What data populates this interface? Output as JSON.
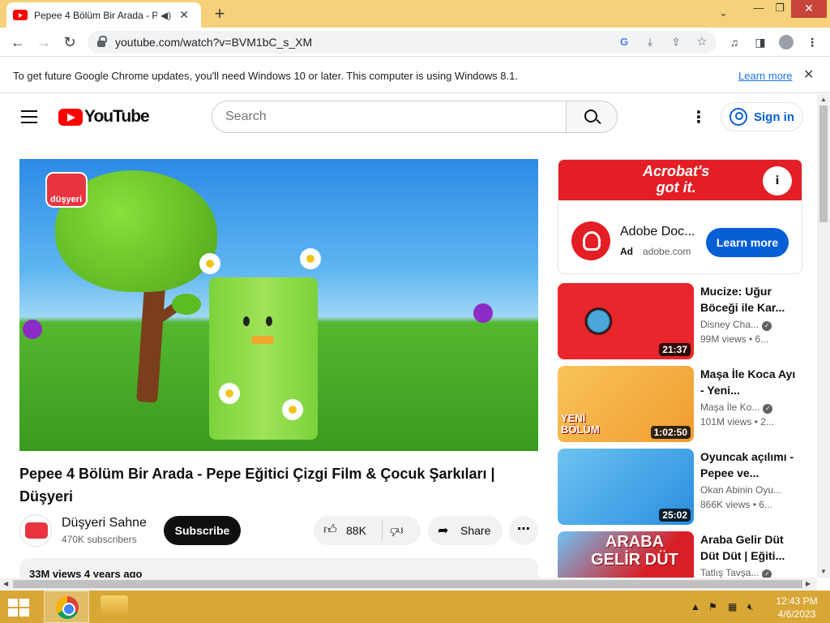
{
  "browser": {
    "tab_title": "Pepee 4 Bölüm Bir Arada - Pe",
    "url": "youtube.com/watch?v=BVM1bC_s_XM",
    "icons": [
      "youtube-favicon",
      "audio-icon",
      "close-icon",
      "new-tab-icon",
      "back-icon",
      "forward-icon",
      "reload-icon",
      "lock-icon",
      "google-icon",
      "download-icon",
      "share-icon",
      "star-icon",
      "media-icon",
      "side-panel-icon",
      "profile-icon",
      "menu-icon"
    ]
  },
  "infobar": {
    "message": "To get future Google Chrome updates, you'll need Windows 10 or later. This computer is using Windows 8.1.",
    "link": "Learn more"
  },
  "youtube": {
    "brand": "YouTube",
    "search_placeholder": "Search",
    "sign_in": "Sign in",
    "brand_color": "#ff0000",
    "accent_color": "#065fd4"
  },
  "player": {
    "channel_mark": "düşyeri"
  },
  "video": {
    "title": "Pepee 4 Bölüm Bir Arada - Pepe Eğitici Çizgi Film & Çocuk Şarkıları | Düşyeri",
    "channel": "Düşyeri Sahne",
    "subscribers": "470K subscribers",
    "subscribe_label": "Subscribe",
    "likes": "88K",
    "share_label": "Share",
    "views_date": "33M views  4 years ago"
  },
  "ad": {
    "banner_text": "Acrobat's\ngot it.",
    "info_icon": "i",
    "title": "Adobe Doc...",
    "label": "Ad",
    "domain": "adobe.com",
    "cta": "Learn more",
    "color": "#e31e24"
  },
  "recommendations": [
    {
      "title": "Mucize: Uğur Böceği ile Kar...",
      "channel": "Disney Cha...",
      "meta": "99M views • 6...",
      "duration": "21:37"
    },
    {
      "title": "Maşa İle Koca Ayı - Yeni...",
      "channel": "Maşa İle Ko...",
      "meta": "101M views • 2...",
      "duration": "1:02:50",
      "thumb_text": "YENİ BÖLÜM"
    },
    {
      "title": "Oyuncak açılımı - Pepee ve...",
      "channel": "Okan Abinin Oyu...",
      "meta": "866K views • 6...",
      "duration": "25:02"
    },
    {
      "title": "Araba Gelir Düt Düt Düt | Eğiti...",
      "channel": "Tatlış Tavşa...",
      "meta": "",
      "duration": "",
      "thumb_text": "ARABA GELİR DÜT"
    }
  ],
  "taskbar": {
    "time": "12:43 PM",
    "date": "4/6/2023"
  }
}
